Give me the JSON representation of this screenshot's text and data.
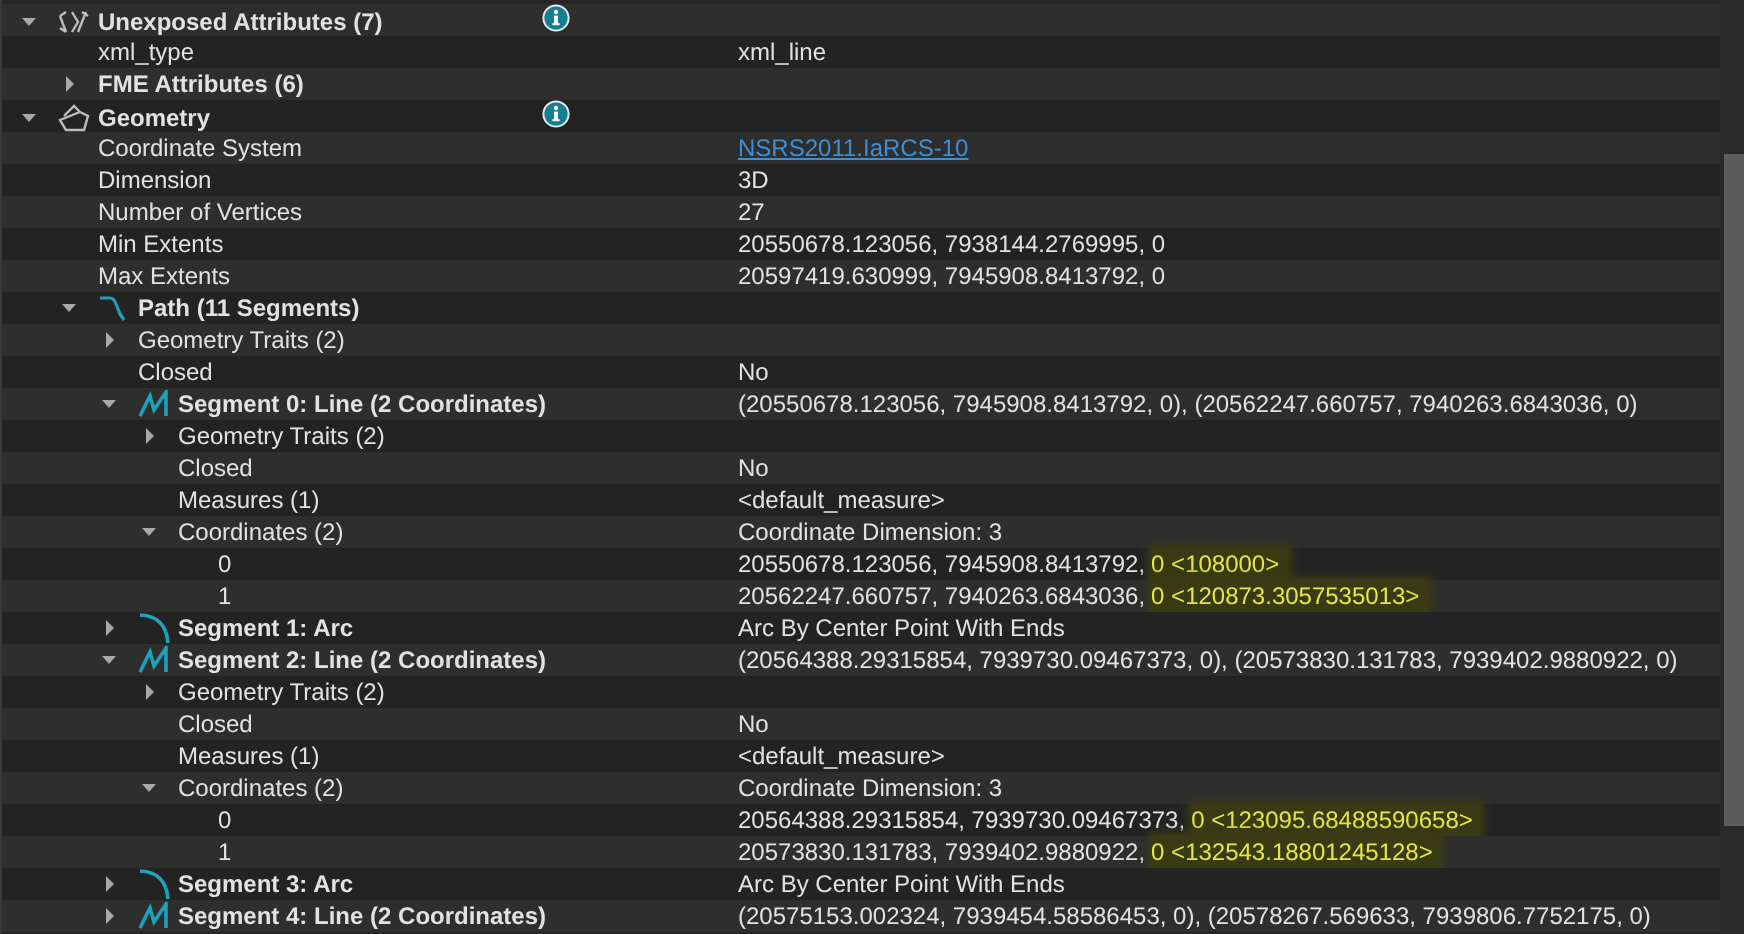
{
  "tree": [
    {
      "label": "Unexposed Attributes (7)",
      "kind": "attributes",
      "info": true,
      "expanded": true,
      "children": [
        {
          "label": "xml_type",
          "value": "xml_line"
        },
        {
          "label": "FME Attributes (6)",
          "kind": "group",
          "expanded": false
        }
      ]
    },
    {
      "label": "Geometry",
      "kind": "geometry",
      "info": true,
      "expanded": true,
      "children": [
        {
          "label": "Coordinate System",
          "value": "NSRS2011.IaRCS-10",
          "kind": "link"
        },
        {
          "label": "Dimension",
          "value": "3D"
        },
        {
          "label": "Number of Vertices",
          "value": "27"
        },
        {
          "label": "Min Extents",
          "value": "20550678.123056, 7938144.2769995, 0"
        },
        {
          "label": "Max Extents",
          "value": "20597419.630999, 7945908.8413792, 0"
        },
        {
          "label": "Path (11 Segments)",
          "kind": "path",
          "expanded": true,
          "children": [
            {
              "label": "Geometry Traits (2)",
              "expanded": false
            },
            {
              "label": "Closed",
              "value": "No"
            },
            {
              "label": "Segment 0: Line (2 Coordinates)",
              "kind": "line",
              "expanded": true,
              "value": "(20550678.123056, 7945908.8413792, 0), (20562247.660757, 7940263.6843036, 0)",
              "children": [
                {
                  "label": "Geometry Traits (2)",
                  "expanded": false
                },
                {
                  "label": "Closed",
                  "value": "No"
                },
                {
                  "label": "Measures (1)",
                  "value": "<default_measure>"
                },
                {
                  "label": "Coordinates (2)",
                  "expanded": true,
                  "value": "Coordinate Dimension: 3",
                  "children": [
                    {
                      "label": "0",
                      "value": "20550678.123056, 7945908.8413792,",
                      "highlight": "0 <108000>"
                    },
                    {
                      "label": "1",
                      "value": "20562247.660757, 7940263.6843036,",
                      "highlight": "0 <120873.3057535013>"
                    }
                  ]
                }
              ]
            },
            {
              "label": "Segment 1: Arc",
              "kind": "arc",
              "expanded": false,
              "value": "Arc By Center Point With Ends"
            },
            {
              "label": "Segment 2: Line (2 Coordinates)",
              "kind": "line",
              "expanded": true,
              "value": "(20564388.29315854, 7939730.09467373, 0), (20573830.131783, 7939402.9880922, 0)",
              "children": [
                {
                  "label": "Geometry Traits (2)",
                  "expanded": false
                },
                {
                  "label": "Closed",
                  "value": "No"
                },
                {
                  "label": "Measures (1)",
                  "value": "<default_measure>"
                },
                {
                  "label": "Coordinates (2)",
                  "expanded": true,
                  "value": "Coordinate Dimension: 3",
                  "children": [
                    {
                      "label": "0",
                      "value": "20564388.29315854, 7939730.09467373,",
                      "highlight": "0 <123095.68488590658>"
                    },
                    {
                      "label": "1",
                      "value": "20573830.131783, 7939402.9880922,",
                      "highlight": "0 <132543.18801245128>"
                    }
                  ]
                }
              ]
            },
            {
              "label": "Segment 3: Arc",
              "kind": "arc",
              "expanded": false,
              "value": "Arc By Center Point With Ends"
            },
            {
              "label": "Segment 4: Line (2 Coordinates)",
              "kind": "line",
              "expanded": false,
              "value": "(20575153.002324, 7939454.58586453, 0), (20578267.569633, 7939806.7752175, 0)"
            }
          ]
        }
      ]
    }
  ]
}
